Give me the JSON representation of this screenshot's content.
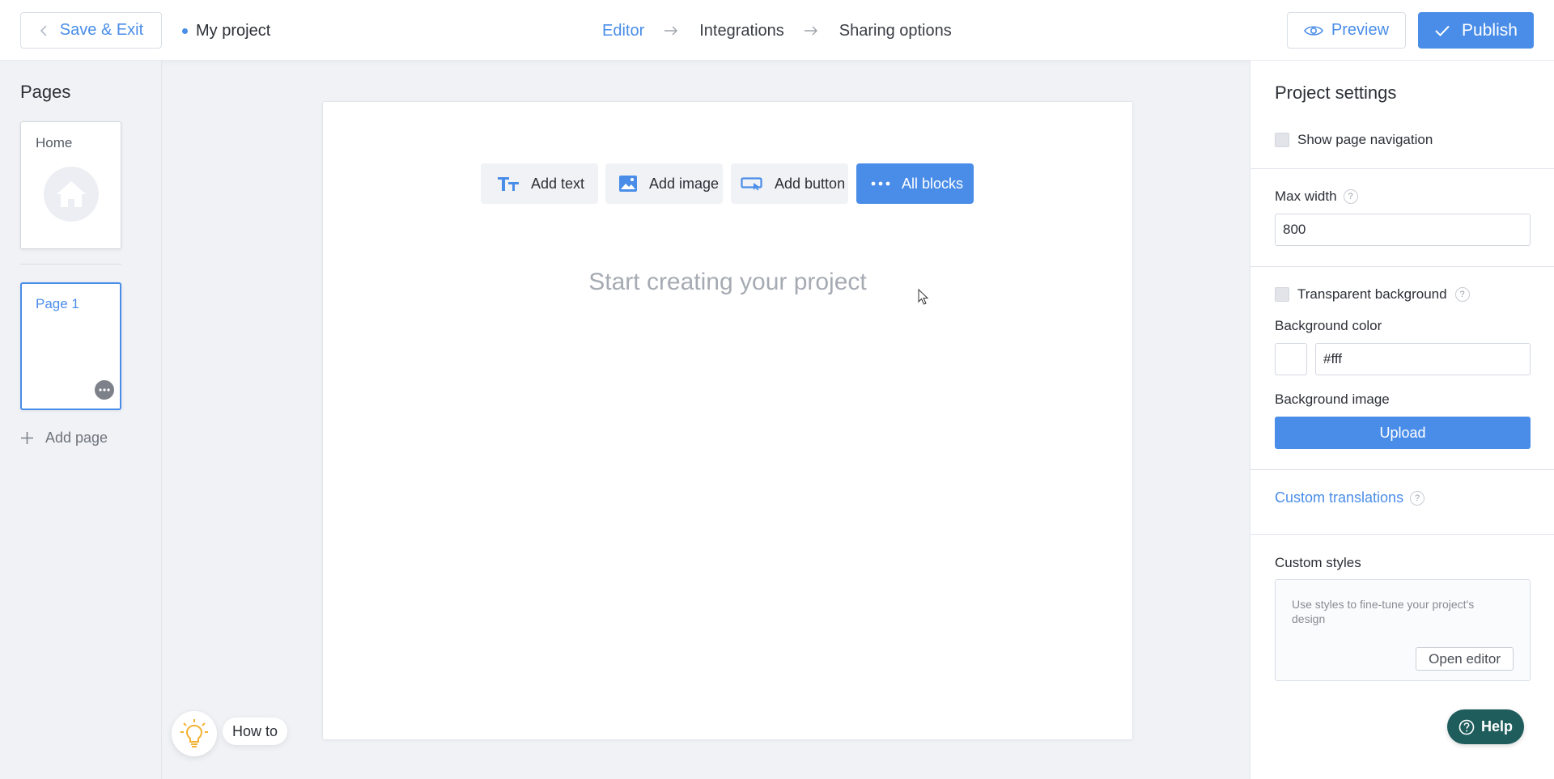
{
  "header": {
    "save_exit_label": "Save & Exit",
    "project_name": "My project",
    "steps": [
      {
        "label": "Editor",
        "active": true
      },
      {
        "label": "Integrations",
        "active": false
      },
      {
        "label": "Sharing options",
        "active": false
      }
    ],
    "preview_label": "Preview",
    "publish_label": "Publish"
  },
  "sidebar": {
    "title": "Pages",
    "pages": [
      {
        "label": "Home"
      },
      {
        "label": "Page 1",
        "selected": true
      }
    ],
    "add_page_label": "Add page",
    "howto_label": "How to"
  },
  "canvas": {
    "blocks": [
      {
        "label": "Add text",
        "icon": "text-icon"
      },
      {
        "label": "Add image",
        "icon": "image-icon"
      },
      {
        "label": "Add button",
        "icon": "button-icon"
      },
      {
        "label": "All blocks",
        "icon": "more-icon"
      }
    ],
    "placeholder": "Start creating your project"
  },
  "settings": {
    "title": "Project settings",
    "show_nav_label": "Show page navigation",
    "max_width_label": "Max width",
    "max_width_value": "800",
    "transparent_bg_label": "Transparent background",
    "bg_color_label": "Background color",
    "bg_color_value": "#fff",
    "bg_image_label": "Background image",
    "upload_label": "Upload",
    "custom_translations_label": "Custom translations",
    "custom_styles_label": "Custom styles",
    "custom_styles_desc": "Use styles to fine-tune your project's design",
    "open_editor_label": "Open editor",
    "help_q": "?"
  },
  "help": {
    "label": "Help"
  },
  "colors": {
    "accent": "#4a8de8",
    "help_bg": "#1f5c5c",
    "background": "#f0f2f6"
  }
}
